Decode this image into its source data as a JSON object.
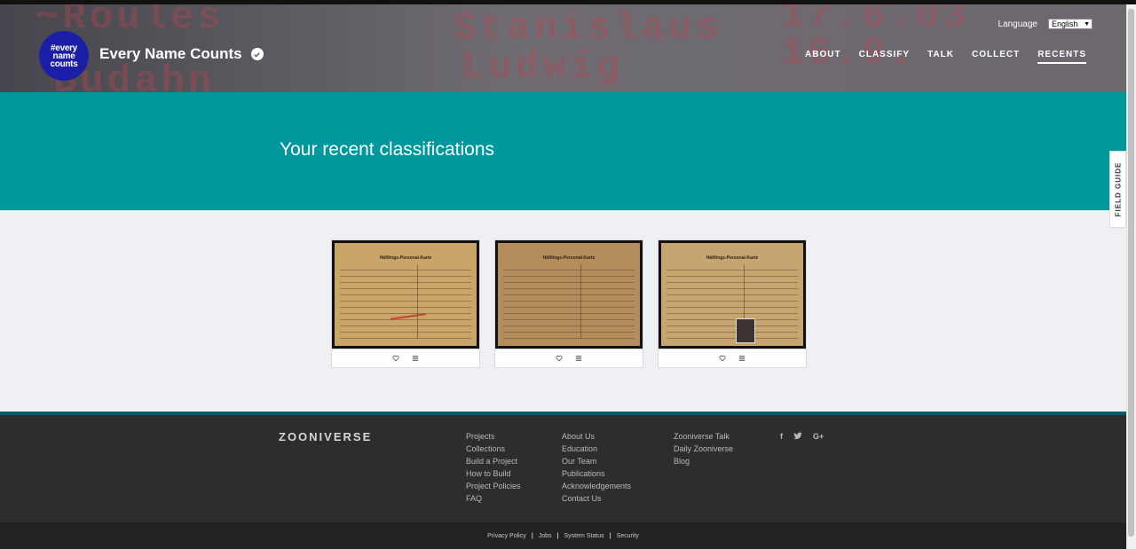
{
  "header": {
    "logo_line1": "#every",
    "logo_line2": "name",
    "logo_line3": "counts",
    "brand_name": "Every Name Counts",
    "language_label": "Language",
    "language_value": "English",
    "nav": [
      "ABOUT",
      "CLASSIFY",
      "TALK",
      "COLLECT",
      "RECENTS"
    ],
    "nav_active": "RECENTS"
  },
  "banner": {
    "title": "Your recent classifications"
  },
  "field_guide_label": "FIELD GUIDE",
  "cards": [
    {
      "doc_title": "Häftlings-Personal-Karte"
    },
    {
      "doc_title": "Häftlings-Personal-Karte"
    },
    {
      "doc_title": "Häftlings-Personal-Karte"
    }
  ],
  "footer": {
    "logo": "ZOONIVERSE",
    "col1": [
      "Projects",
      "Collections",
      "Build a Project",
      "How to Build",
      "Project Policies",
      "FAQ"
    ],
    "col2": [
      "About Us",
      "Education",
      "Our Team",
      "Publications",
      "Acknowledgements",
      "Contact Us"
    ],
    "col3": [
      "Zooniverse Talk",
      "Daily Zooniverse",
      "Blog"
    ],
    "socials": [
      "f",
      "t",
      "G+"
    ],
    "bottom_links": [
      "Privacy Policy",
      "Jobs",
      "System Status",
      "Security"
    ]
  },
  "colors": {
    "teal": "#00979d",
    "footer": "#2d2d2d",
    "logo_blue": "#1b1fa8"
  }
}
